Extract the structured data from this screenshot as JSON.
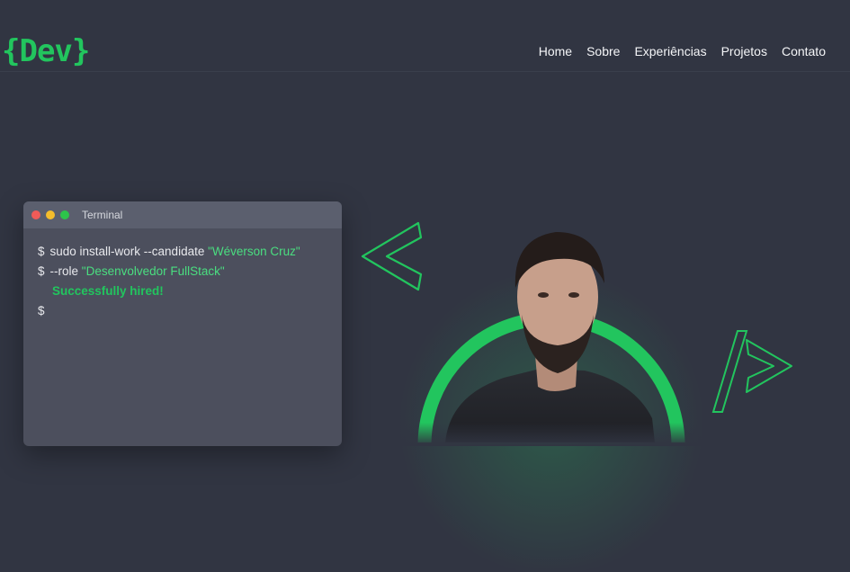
{
  "header": {
    "logo": "{Dev}",
    "nav": [
      "Home",
      "Sobre",
      "Experiências",
      "Projetos",
      "Contato"
    ]
  },
  "terminal": {
    "title": "Terminal",
    "lines": [
      {
        "prompt": "$",
        "cmd": "sudo install-work --candidate ",
        "arg": "\"Wéverson Cruz\""
      },
      {
        "prompt": "$",
        "cmd": "--role ",
        "arg": "\"Desenvolvedor FullStack\""
      }
    ],
    "success": "Successfully hired!",
    "last_prompt": "$"
  },
  "hero": {
    "left_symbol_icon": "less-than-icon",
    "right_symbol_icon": "closing-tag-icon",
    "photo": "profile-photo"
  },
  "colors": {
    "background": "#313542",
    "accent": "#22c55e",
    "terminal_bg": "#4c4f5d",
    "terminal_bar": "#5b5f6e"
  }
}
